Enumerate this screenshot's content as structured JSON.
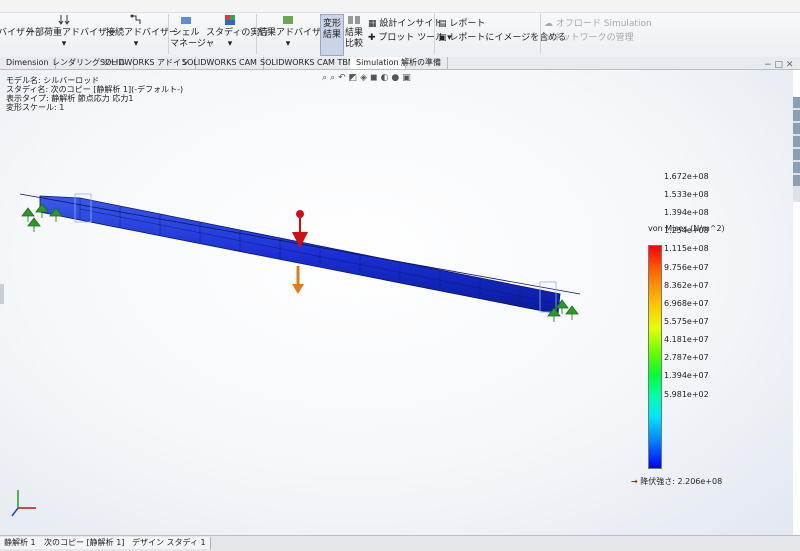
{
  "ribbon": {
    "buttons": [
      {
        "label": "バイザー"
      },
      {
        "label": "外部荷重アドバイザー",
        "sub": "▾"
      },
      {
        "label": "接続アドバイザー",
        "sub": "▾"
      },
      {
        "label": "シェル",
        "sub": "マネージャ"
      },
      {
        "label": "スタディの実行",
        "sub": "▾"
      },
      {
        "label": "結果アドバイザー",
        "sub": "▾"
      },
      {
        "label": "変形",
        "sub": "結果"
      },
      {
        "label": "結果",
        "sub": "比較"
      }
    ],
    "small": {
      "design_insight": "設計インサイト",
      "plot_tool": "プロット ツール",
      "report": "レポート",
      "include_image": "レポートにイメージを含める",
      "offload": "オフロード Simulation",
      "network": "ネットワークの管理"
    }
  },
  "tabs": [
    "Dimension",
    "レンダリング ツール",
    "SOLIDWORKS アドイン",
    "SOLIDWORKS CAM",
    "SOLIDWORKS CAM TBM",
    "Simulation",
    "解析の準備"
  ],
  "active_tab": "Simulation",
  "info": {
    "model": "モデル名: シルバーロッド",
    "study": "スタディ名: 次のコピー [静解析 1](-デフォルト-)",
    "plot": "表示タイプ: 静解析 節点応力 応力1",
    "scale": "変形スケール: 1"
  },
  "legend": {
    "title": "von Mises (N/m^2)",
    "ticks": [
      "1.672e+08",
      "1.533e+08",
      "1.394e+08",
      "1.254e+08",
      "1.115e+08",
      "9.756e+07",
      "8.362e+07",
      "6.968e+07",
      "5.575e+07",
      "4.181e+07",
      "2.787e+07",
      "1.394e+07",
      "5.981e+02"
    ],
    "yield": "降伏強さ: 2.206e+08",
    "colors": {
      "max": "#ff0000",
      "min": "#0000ff"
    }
  },
  "statusbar": {
    "tabs": [
      "静解析 1",
      "次のコピー [静解析 1]",
      "デザイン スタディ 1"
    ]
  }
}
